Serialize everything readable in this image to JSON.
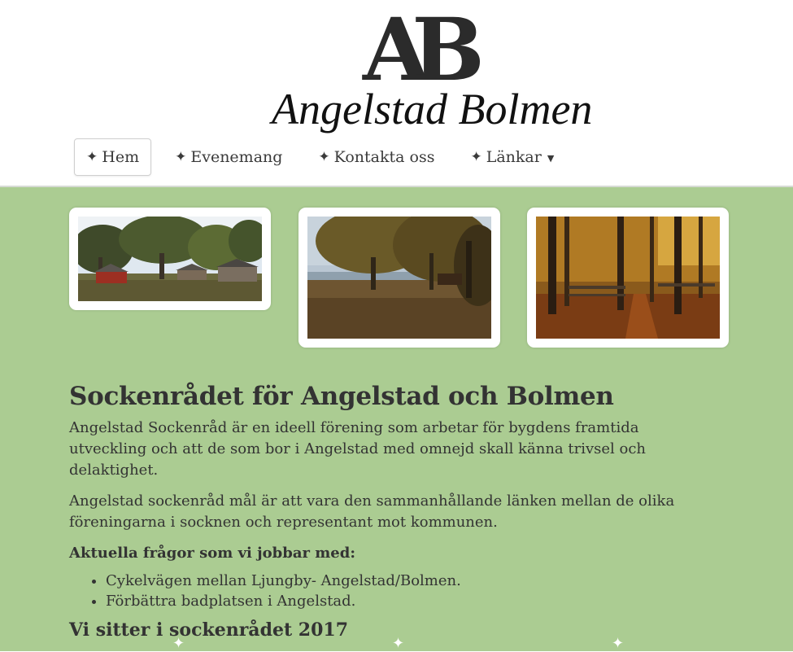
{
  "logo": {
    "monogram": "AB",
    "script_text": "Angelstad Bolmen"
  },
  "nav": {
    "items": [
      {
        "icon": "star-icon",
        "label": "Hem"
      },
      {
        "icon": "star-icon",
        "label": "Evenemang"
      },
      {
        "icon": "star-icon",
        "label": "Kontakta oss"
      },
      {
        "icon": "star-icon",
        "label": "Länkar",
        "has_dropdown": true
      }
    ],
    "star_glyph": "✦",
    "caret_glyph": "▼"
  },
  "gallery": {
    "photos": [
      {
        "subject": "red cabins and large oaks in a meadow"
      },
      {
        "subject": "autumn trees by a lake"
      },
      {
        "subject": "autumn forest path with fence"
      }
    ]
  },
  "content": {
    "title": "Sockenrådet för Angelstad och Bolmen",
    "paragraph1": "Angelstad Sockenråd är en ideell förening som arbetar för bygdens framtida utveckling och att de som bor i Angelstad med omnejd skall känna trivsel och delaktighet.",
    "paragraph2": "Angelstad sockenråd mål är att vara den sammanhållande länken mellan de olika föreningarna i socknen och representant mot kommunen.",
    "subheading": "Aktuella frågor som vi jobbar med:",
    "issues": [
      "Cykelvägen mellan Ljungby- Angelstad/Bolmen.",
      "Förbättra badplatsen i Angelstad."
    ],
    "section_title": "Vi sitter i sockenrådet 2017"
  },
  "colors": {
    "background_green": "#abcc92",
    "text": "#333333",
    "header_bg": "#ffffff"
  }
}
